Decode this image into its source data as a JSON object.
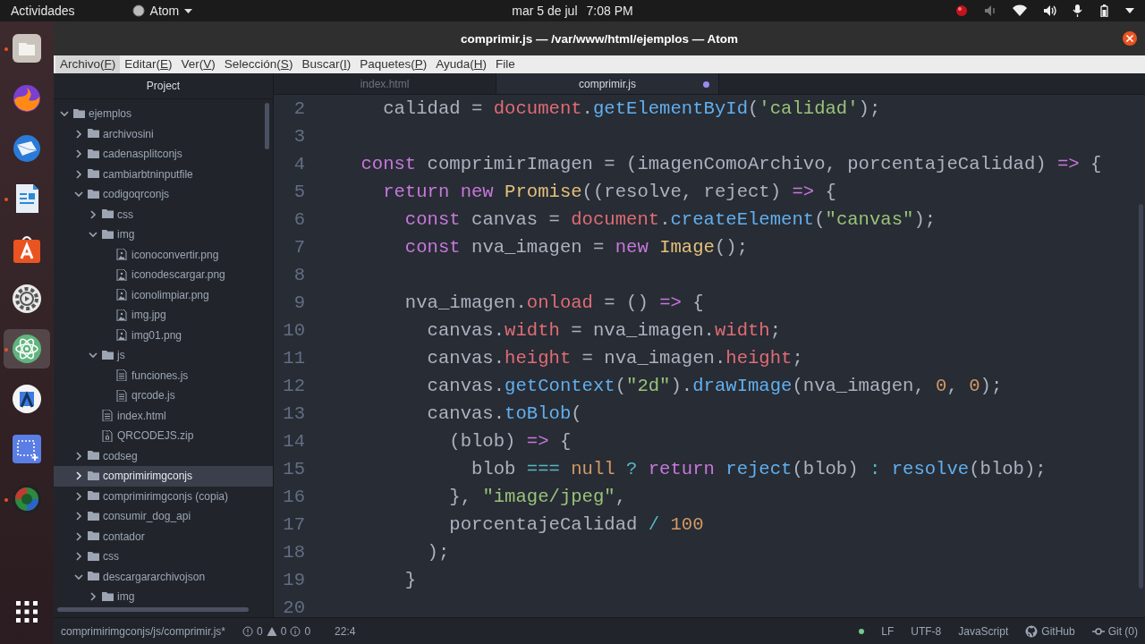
{
  "top_bar": {
    "activities": "Actividades",
    "app": "Atom",
    "date": "mar 5 de jul",
    "time": "7:08 PM"
  },
  "dock": [
    {
      "kind": "files",
      "running": true,
      "active": false
    },
    {
      "kind": "browser",
      "running": false,
      "active": false
    },
    {
      "kind": "mail",
      "running": false,
      "active": false
    },
    {
      "kind": "writer",
      "running": true,
      "active": false
    },
    {
      "kind": "store",
      "running": false,
      "active": false
    },
    {
      "kind": "settings",
      "running": false,
      "active": false
    },
    {
      "kind": "atom",
      "running": true,
      "active": true
    },
    {
      "kind": "studio",
      "running": false,
      "active": false
    },
    {
      "kind": "screenshot",
      "running": false,
      "active": false
    },
    {
      "kind": "globe",
      "running": true,
      "active": false
    },
    {
      "kind": "apps",
      "running": false,
      "active": false
    }
  ],
  "window": {
    "title": "comprimir.js — /var/www/html/ejemplos — Atom"
  },
  "menu": [
    {
      "label": "Archivo(F)",
      "underlined_key": true,
      "selected": true
    },
    {
      "label": "Editar(E)",
      "underlined_key": true,
      "selected": false
    },
    {
      "label": "Ver(V)",
      "underlined_key": true,
      "selected": false
    },
    {
      "label": "Selección(S)",
      "underlined_key": true,
      "selected": false
    },
    {
      "label": "Buscar(I)",
      "underlined_key": true,
      "selected": false
    },
    {
      "label": "Paquetes(P)",
      "underlined_key": true,
      "selected": false
    },
    {
      "label": "Ayuda(H)",
      "underlined_key": true,
      "selected": false
    },
    {
      "label": "File",
      "underlined_key": false,
      "selected": false
    }
  ],
  "tree": {
    "title": "Project",
    "items": [
      {
        "kind": "folder",
        "name": "ejemplos",
        "expanded": true,
        "selected": false,
        "children": [
          {
            "kind": "folder",
            "name": "archivosini",
            "expanded": false,
            "selected": false
          },
          {
            "kind": "folder",
            "name": "cadenasplitconjs",
            "expanded": false,
            "selected": false
          },
          {
            "kind": "folder",
            "name": "cambiarbtninputfile",
            "expanded": false,
            "selected": false
          },
          {
            "kind": "folder",
            "name": "codigoqrconjs",
            "expanded": true,
            "selected": false,
            "children": [
              {
                "kind": "folder",
                "name": "css",
                "expanded": false,
                "selected": false
              },
              {
                "kind": "folder",
                "name": "img",
                "expanded": true,
                "selected": false,
                "children": [
                  {
                    "kind": "image",
                    "name": "iconoconvertir.png",
                    "selected": false
                  },
                  {
                    "kind": "image",
                    "name": "iconodescargar.png",
                    "selected": false
                  },
                  {
                    "kind": "image",
                    "name": "iconolimpiar.png",
                    "selected": false
                  },
                  {
                    "kind": "image",
                    "name": "img.jpg",
                    "selected": false
                  },
                  {
                    "kind": "image",
                    "name": "img01.png",
                    "selected": false
                  }
                ]
              },
              {
                "kind": "folder",
                "name": "js",
                "expanded": true,
                "selected": false,
                "children": [
                  {
                    "kind": "file",
                    "name": "funciones.js",
                    "selected": false
                  },
                  {
                    "kind": "file",
                    "name": "qrcode.js",
                    "selected": false
                  }
                ]
              },
              {
                "kind": "file",
                "name": "index.html",
                "selected": false
              },
              {
                "kind": "zip",
                "name": "QRCODEJS.zip",
                "selected": false
              }
            ]
          },
          {
            "kind": "folder",
            "name": "codseg",
            "expanded": false,
            "selected": false
          },
          {
            "kind": "folder",
            "name": "comprimirimgconjs",
            "expanded": false,
            "selected": true
          },
          {
            "kind": "folder",
            "name": "comprimirimgconjs (copia)",
            "expanded": false,
            "selected": false
          },
          {
            "kind": "folder",
            "name": "consumir_dog_api",
            "expanded": false,
            "selected": false
          },
          {
            "kind": "folder",
            "name": "contador",
            "expanded": false,
            "selected": false
          },
          {
            "kind": "folder",
            "name": "css",
            "expanded": false,
            "selected": false
          },
          {
            "kind": "folder",
            "name": "descargararchivojson",
            "expanded": true,
            "selected": false,
            "children": [
              {
                "kind": "folder",
                "name": "img",
                "expanded": false,
                "selected": false
              }
            ]
          }
        ]
      }
    ]
  },
  "tabs": [
    {
      "label": "index.html",
      "selected": false,
      "modified": false
    },
    {
      "label": "comprimir.js",
      "selected": true,
      "modified": true
    }
  ],
  "editor": {
    "lines": [
      {
        "number": "2",
        "tokens": [
          {
            "kind": "plain",
            "text": "      calidad = "
          },
          {
            "kind": "property",
            "text": "document"
          },
          {
            "kind": "plain",
            "text": "."
          },
          {
            "kind": "function",
            "text": "getElementById"
          },
          {
            "kind": "plain",
            "text": "("
          },
          {
            "kind": "string",
            "text": "'calidad'"
          },
          {
            "kind": "plain",
            "text": ");"
          }
        ]
      },
      {
        "number": "3"
      },
      {
        "number": "4",
        "tokens": [
          {
            "kind": "keyword",
            "text": "    const"
          },
          {
            "kind": "plain",
            "text": " comprimirImagen = (imagenComoArchivo, porcentajeCalidad) "
          },
          {
            "kind": "keyword",
            "text": "=>"
          },
          {
            "kind": "plain",
            "text": " {"
          }
        ]
      },
      {
        "number": "5",
        "tokens": [
          {
            "kind": "keyword",
            "text": "      return new"
          },
          {
            "kind": "type",
            "text": " Promise"
          },
          {
            "kind": "plain",
            "text": "((resolve, reject) "
          },
          {
            "kind": "keyword",
            "text": "=>"
          },
          {
            "kind": "plain",
            "text": " {"
          }
        ]
      },
      {
        "number": "6",
        "tokens": [
          {
            "kind": "keyword",
            "text": "        const"
          },
          {
            "kind": "plain",
            "text": " canvas = "
          },
          {
            "kind": "property",
            "text": "document"
          },
          {
            "kind": "plain",
            "text": "."
          },
          {
            "kind": "function",
            "text": "createElement"
          },
          {
            "kind": "plain",
            "text": "("
          },
          {
            "kind": "string",
            "text": "\"canvas\""
          },
          {
            "kind": "plain",
            "text": ");"
          }
        ]
      },
      {
        "number": "7",
        "tokens": [
          {
            "kind": "keyword",
            "text": "        const"
          },
          {
            "kind": "plain",
            "text": " nva_imagen = "
          },
          {
            "kind": "keyword",
            "text": "new"
          },
          {
            "kind": "type",
            "text": " Image"
          },
          {
            "kind": "plain",
            "text": "();"
          }
        ]
      },
      {
        "number": "8"
      },
      {
        "number": "9",
        "tokens": [
          {
            "kind": "plain",
            "text": "        nva_imagen."
          },
          {
            "kind": "property",
            "text": "onload"
          },
          {
            "kind": "plain",
            "text": " = () "
          },
          {
            "kind": "keyword",
            "text": "=>"
          },
          {
            "kind": "plain",
            "text": " {"
          }
        ]
      },
      {
        "number": "10",
        "tokens": [
          {
            "kind": "plain",
            "text": "          canvas."
          },
          {
            "kind": "property",
            "text": "width"
          },
          {
            "kind": "plain",
            "text": " = nva_imagen."
          },
          {
            "kind": "property",
            "text": "width"
          },
          {
            "kind": "plain",
            "text": ";"
          }
        ]
      },
      {
        "number": "11",
        "tokens": [
          {
            "kind": "plain",
            "text": "          canvas."
          },
          {
            "kind": "property",
            "text": "height"
          },
          {
            "kind": "plain",
            "text": " = nva_imagen."
          },
          {
            "kind": "property",
            "text": "height"
          },
          {
            "kind": "plain",
            "text": ";"
          }
        ]
      },
      {
        "number": "12",
        "tokens": [
          {
            "kind": "plain",
            "text": "          canvas."
          },
          {
            "kind": "function",
            "text": "getContext"
          },
          {
            "kind": "plain",
            "text": "("
          },
          {
            "kind": "string",
            "text": "\"2d\""
          },
          {
            "kind": "plain",
            "text": ")."
          },
          {
            "kind": "function",
            "text": "drawImage"
          },
          {
            "kind": "plain",
            "text": "(nva_imagen, "
          },
          {
            "kind": "number",
            "text": "0"
          },
          {
            "kind": "plain",
            "text": ", "
          },
          {
            "kind": "number",
            "text": "0"
          },
          {
            "kind": "plain",
            "text": ");"
          }
        ]
      },
      {
        "number": "13",
        "tokens": [
          {
            "kind": "plain",
            "text": "          canvas."
          },
          {
            "kind": "function",
            "text": "toBlob"
          },
          {
            "kind": "plain",
            "text": "("
          }
        ]
      },
      {
        "number": "14",
        "tokens": [
          {
            "kind": "plain",
            "text": "            (blob) "
          },
          {
            "kind": "keyword",
            "text": "=>"
          },
          {
            "kind": "plain",
            "text": " {"
          }
        ]
      },
      {
        "number": "15",
        "tokens": [
          {
            "kind": "plain",
            "text": "              blob "
          },
          {
            "kind": "operator",
            "text": "==="
          },
          {
            "kind": "number",
            "text": " null"
          },
          {
            "kind": "operator",
            "text": " ?"
          },
          {
            "kind": "keyword",
            "text": " return"
          },
          {
            "kind": "function",
            "text": " reject"
          },
          {
            "kind": "plain",
            "text": "(blob) "
          },
          {
            "kind": "operator",
            "text": ":"
          },
          {
            "kind": "function",
            "text": " resolve"
          },
          {
            "kind": "plain",
            "text": "(blob);"
          }
        ]
      },
      {
        "number": "16",
        "tokens": [
          {
            "kind": "plain",
            "text": "            }, "
          },
          {
            "kind": "string",
            "text": "\"image/jpeg\""
          },
          {
            "kind": "plain",
            "text": ","
          }
        ]
      },
      {
        "number": "17",
        "tokens": [
          {
            "kind": "plain",
            "text": "            porcentajeCalidad "
          },
          {
            "kind": "operator",
            "text": "/"
          },
          {
            "kind": "number",
            "text": " 100"
          }
        ]
      },
      {
        "number": "18",
        "tokens": [
          {
            "kind": "plain",
            "text": "          );"
          }
        ]
      },
      {
        "number": "19",
        "tokens": [
          {
            "kind": "plain",
            "text": "        }"
          }
        ]
      },
      {
        "number": "20"
      }
    ]
  },
  "status_bar": {
    "path": "comprimirimgconjs/js/comprimir.js*",
    "errors": "0",
    "warnings": "0",
    "infos": "0",
    "cursor": "22:4",
    "line_ending": "LF",
    "encoding": "UTF-8",
    "grammar": "JavaScript",
    "github": "GitHub",
    "git": "Git (0)"
  }
}
